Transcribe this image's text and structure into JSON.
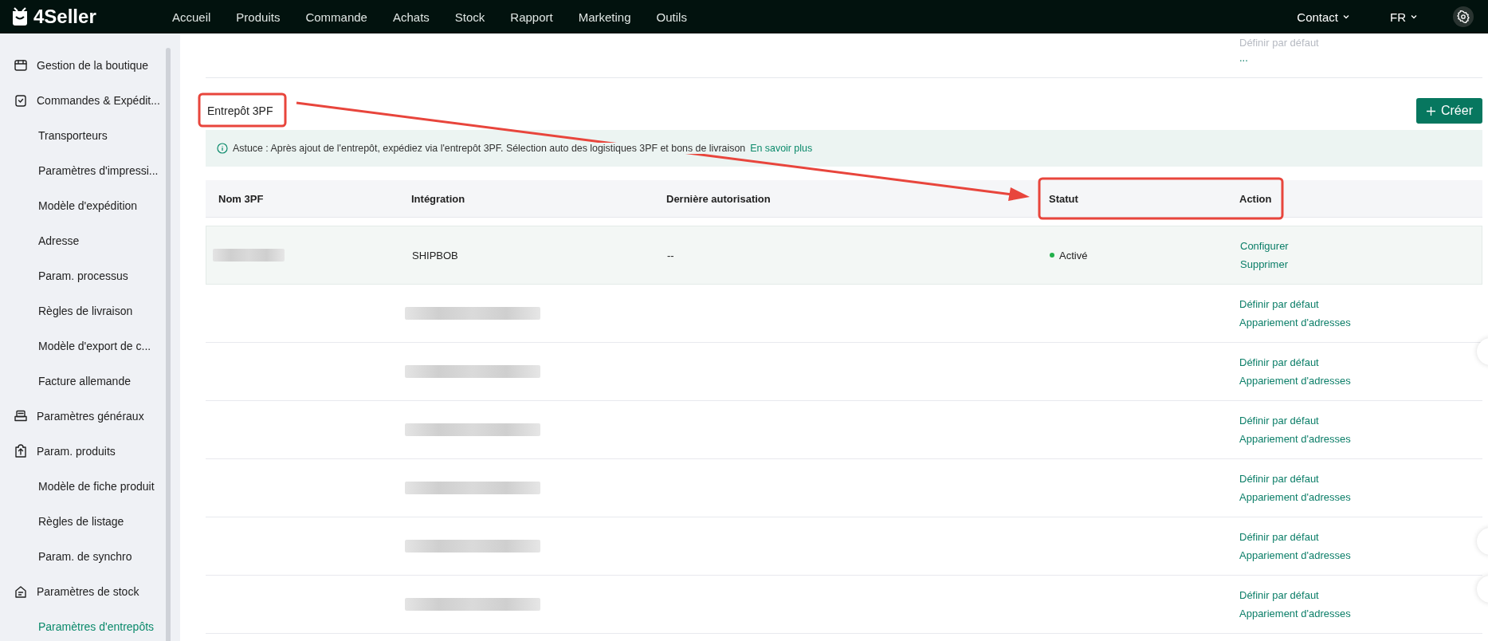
{
  "topbar": {
    "logo": "4Seller",
    "nav": [
      {
        "label": "Accueil"
      },
      {
        "label": "Produits"
      },
      {
        "label": "Commande"
      },
      {
        "label": "Achats"
      },
      {
        "label": "Stock"
      },
      {
        "label": "Rapport"
      },
      {
        "label": "Marketing"
      },
      {
        "label": "Outils"
      }
    ],
    "contact": "Contact",
    "language": "FR"
  },
  "sidebar": {
    "items": [
      {
        "label": "Gestion de la boutique",
        "kind": "shop",
        "selected": false
      },
      {
        "label": "Commandes & Expédit...",
        "kind": "clipboard",
        "selected": false,
        "children": [
          {
            "label": "Transporteurs",
            "selected": false
          },
          {
            "label": "Paramètres d'impressi...",
            "selected": false
          },
          {
            "label": "Modèle d'expédition",
            "selected": false
          },
          {
            "label": "Adresse",
            "selected": false
          },
          {
            "label": "Param. processus",
            "selected": false
          },
          {
            "label": "Règles de livraison",
            "selected": false
          },
          {
            "label": "Modèle d'export de c...",
            "selected": false
          },
          {
            "label": "Facture allemande",
            "selected": false
          }
        ]
      },
      {
        "label": "Paramètres généraux",
        "kind": "printer",
        "selected": false
      },
      {
        "label": "Param. produits",
        "kind": "upload",
        "selected": false,
        "children": [
          {
            "label": "Modèle de fiche produit",
            "selected": false
          },
          {
            "label": "Règles de listage",
            "selected": false
          },
          {
            "label": "Param. de synchro",
            "selected": false
          }
        ]
      },
      {
        "label": "Paramètres de stock",
        "kind": "house",
        "selected": false,
        "children": [
          {
            "label": "Paramètres d'entrepôts",
            "selected": true
          }
        ]
      }
    ]
  },
  "previous_section": {
    "actions": [
      {
        "label": "Définir par défaut",
        "disabled": true
      },
      {
        "label": "...",
        "disabled": false
      }
    ]
  },
  "section": {
    "title": "Entrepôt 3PF",
    "create_button": "Créer",
    "tip": "Astuce : Après ajout de l'entrepôt, expédiez via l'entrepôt 3PF. Sélection auto des logistiques 3PF et bons de livraison",
    "tip_link": "En savoir plus"
  },
  "table": {
    "columns": [
      "Nom 3PF",
      "Intégration",
      "Dernière autorisation",
      "Statut",
      "Action"
    ],
    "rows": [
      {
        "name_redacted": true,
        "integration": "SHIPBOB",
        "integration_redacted": false,
        "last_authorization": "--",
        "status": {
          "label": "Activé",
          "color": "#22b04b"
        },
        "highlighted": true,
        "actions": [
          "Configurer",
          "Supprimer"
        ]
      },
      {
        "name_redacted": false,
        "integration_redacted": true,
        "highlighted": false,
        "actions": [
          "Définir par défaut",
          "Appariement d'adresses"
        ]
      },
      {
        "name_redacted": false,
        "integration_redacted": true,
        "highlighted": false,
        "actions": [
          "Définir par défaut",
          "Appariement d'adresses"
        ]
      },
      {
        "name_redacted": false,
        "integration_redacted": true,
        "highlighted": false,
        "actions": [
          "Définir par défaut",
          "Appariement d'adresses"
        ]
      },
      {
        "name_redacted": false,
        "integration_redacted": true,
        "highlighted": false,
        "actions": [
          "Définir par défaut",
          "Appariement d'adresses"
        ]
      },
      {
        "name_redacted": false,
        "integration_redacted": true,
        "highlighted": false,
        "actions": [
          "Définir par défaut",
          "Appariement d'adresses"
        ]
      },
      {
        "name_redacted": false,
        "integration_redacted": true,
        "highlighted": false,
        "actions": [
          "Définir par défaut",
          "Appariement d'adresses"
        ]
      }
    ]
  }
}
